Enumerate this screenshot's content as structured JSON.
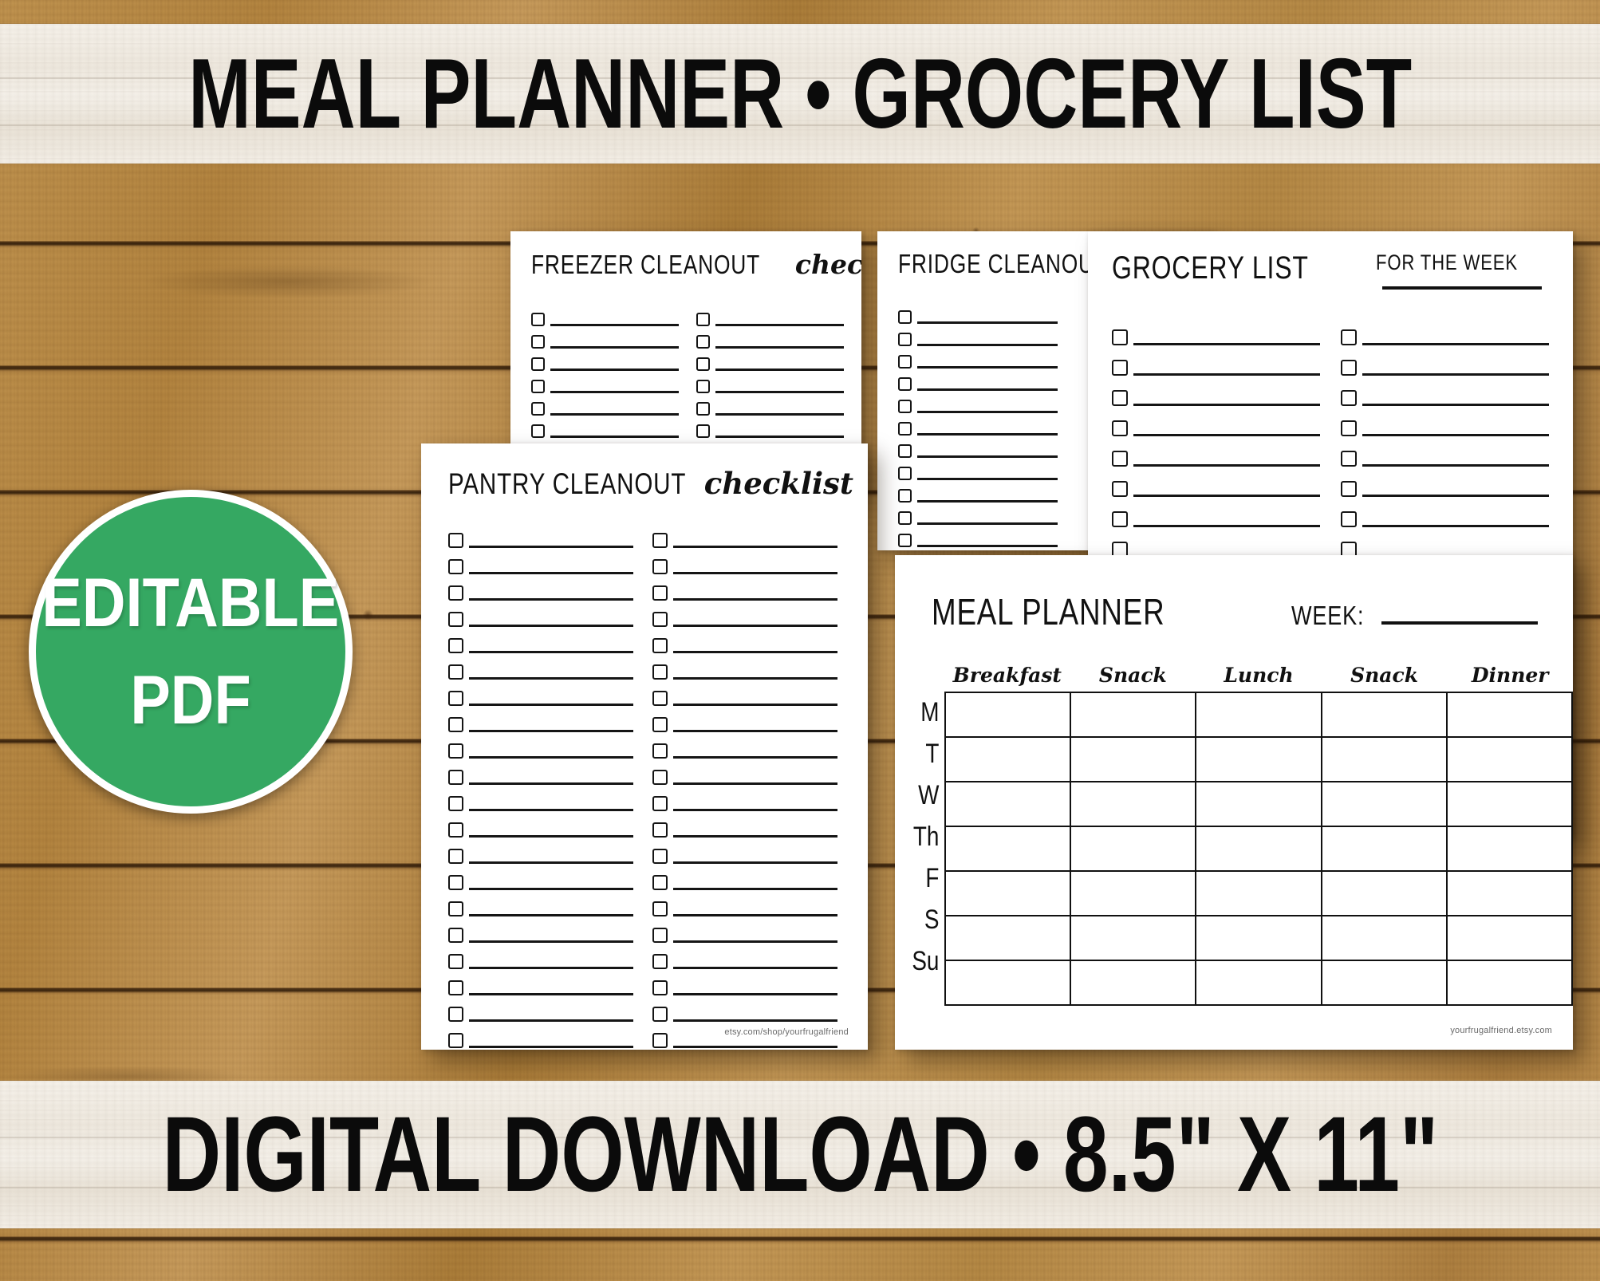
{
  "banner": {
    "title": "MEAL PLANNER • GROCERY LIST",
    "footer": "DIGITAL DOWNLOAD • 8.5\" X 11\""
  },
  "badge": {
    "line1": "EDITABLE",
    "line2": "PDF",
    "color": "#35a862",
    "ring_color": "#ffffff"
  },
  "sheets": {
    "freezer": {
      "title_caps": "FREEZER CLEANOUT",
      "title_script": "checklist",
      "rows_per_column": 6,
      "columns": 2
    },
    "fridge": {
      "title_caps": "FRIDGE CLEANOUT",
      "rows_per_column": 11,
      "columns": 1
    },
    "grocery": {
      "title_caps": "GROCERY LIST",
      "subtitle": "FOR THE WEEK",
      "rows_per_column": 11,
      "columns": 2
    },
    "pantry": {
      "title_caps": "PANTRY CLEANOUT",
      "title_script": "checklist",
      "rows_per_column": 20,
      "columns": 2,
      "footer_url": "etsy.com/shop/yourfrugalfriend"
    },
    "planner": {
      "title": "MEAL PLANNER",
      "week_label": "WEEK:",
      "column_headers": [
        "Breakfast",
        "Snack",
        "Lunch",
        "Snack",
        "Dinner"
      ],
      "day_labels": [
        "M",
        "T",
        "W",
        "Th",
        "F",
        "S",
        "Su"
      ],
      "footer_url": "yourfrugalfriend.etsy.com"
    }
  },
  "background": {
    "wood_color": "#bd914f",
    "banner_color": "#f4efe7"
  }
}
